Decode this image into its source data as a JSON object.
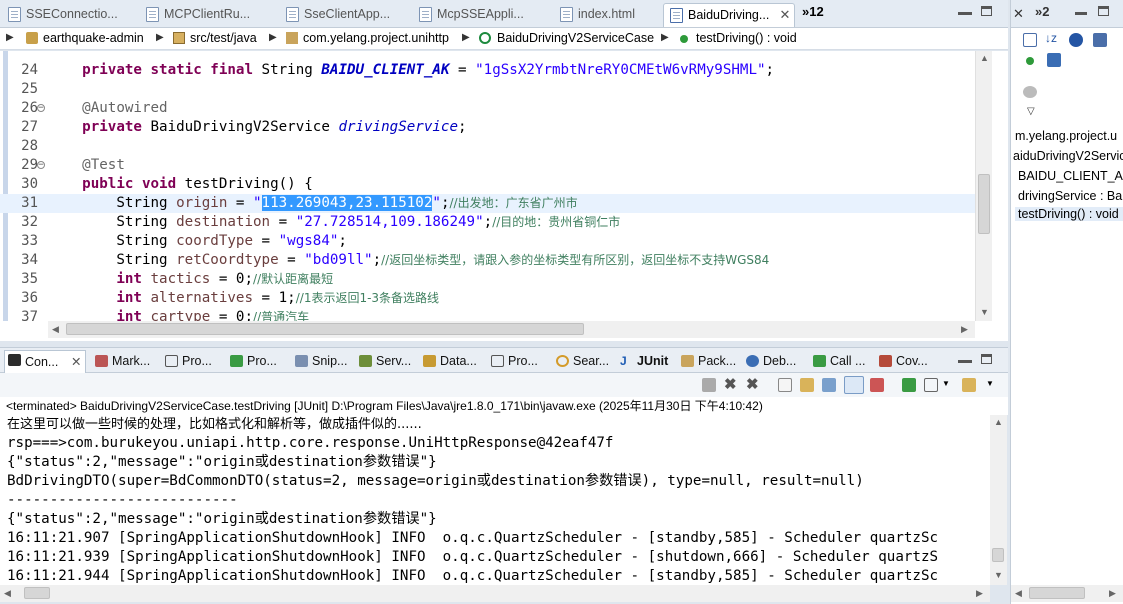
{
  "editor_tabs": [
    {
      "label": "SSEConnectio..."
    },
    {
      "label": "MCPClientRu..."
    },
    {
      "label": "SseClientApp..."
    },
    {
      "label": "McpSSEAppli..."
    },
    {
      "label": "index.html"
    },
    {
      "label": "BaiduDriving..."
    }
  ],
  "editor_overflow": "»12",
  "breadcrumb": {
    "project": "earthquake-admin",
    "folder": "src/test/java",
    "package": "com.yelang.project.unihttp",
    "class": "BaiduDrivingV2ServiceCase",
    "method": "testDriving() : void"
  },
  "code_lines": [
    {
      "n": "24",
      "parts": [
        [
          "    ",
          ""
        ],
        [
          "private static final",
          "kw"
        ],
        [
          " String ",
          ""
        ],
        [
          "BAIDU_CLIENT_AK",
          "fld"
        ],
        [
          " = ",
          ""
        ],
        [
          "\"1gSsX2YrmbtNreRY0CMEtW6vRMy9SHML\"",
          "st"
        ],
        [
          ";",
          ""
        ]
      ]
    },
    {
      "n": "25",
      "parts": []
    },
    {
      "n": "26",
      "parts": [
        [
          "    ",
          ""
        ],
        [
          "@Autowired",
          "an"
        ]
      ]
    },
    {
      "n": "27",
      "parts": [
        [
          "    ",
          ""
        ],
        [
          "private",
          "kw"
        ],
        [
          " BaiduDrivingV2Service ",
          ""
        ],
        [
          "drivingService",
          "fld2"
        ],
        [
          ";",
          ""
        ]
      ]
    },
    {
      "n": "28",
      "parts": []
    },
    {
      "n": "29",
      "parts": [
        [
          "    ",
          ""
        ],
        [
          "@Test",
          "an"
        ]
      ]
    },
    {
      "n": "30",
      "parts": [
        [
          "    ",
          ""
        ],
        [
          "public void",
          "kw"
        ],
        [
          " testDriving() {",
          ""
        ]
      ]
    },
    {
      "n": "31",
      "parts": [
        [
          "        String ",
          ""
        ],
        [
          "origin",
          "vr"
        ],
        [
          " = ",
          ""
        ],
        [
          "\"",
          "st"
        ],
        [
          "113.269043,23.115102",
          "sel"
        ],
        [
          "\"",
          "st"
        ],
        [
          ";",
          ""
        ],
        [
          "//出发地：广东省广州市",
          "cm"
        ]
      ]
    },
    {
      "n": "32",
      "parts": [
        [
          "        String ",
          ""
        ],
        [
          "destination",
          "vr"
        ],
        [
          " = ",
          ""
        ],
        [
          "\"27.728514,109.186249\"",
          "st"
        ],
        [
          ";",
          ""
        ],
        [
          "//目的地：贵州省铜仁市",
          "cm"
        ]
      ]
    },
    {
      "n": "33",
      "parts": [
        [
          "        String ",
          ""
        ],
        [
          "coordType",
          "vr"
        ],
        [
          " = ",
          ""
        ],
        [
          "\"wgs84\"",
          "st"
        ],
        [
          ";",
          ""
        ]
      ]
    },
    {
      "n": "34",
      "parts": [
        [
          "        String ",
          ""
        ],
        [
          "retCoordtype",
          "vr"
        ],
        [
          " = ",
          ""
        ],
        [
          "\"bd09ll\"",
          "st"
        ],
        [
          ";",
          ""
        ],
        [
          "//返回坐标类型，请跟入参的坐标类型有所区别，返回坐标不支持WGS84",
          "cm"
        ]
      ]
    },
    {
      "n": "35",
      "parts": [
        [
          "        ",
          ""
        ],
        [
          "int",
          "kw"
        ],
        [
          " ",
          ""
        ],
        [
          "tactics",
          "vr"
        ],
        [
          " = 0;",
          ""
        ],
        [
          "//默认距离最短",
          "cm"
        ]
      ]
    },
    {
      "n": "36",
      "parts": [
        [
          "        ",
          ""
        ],
        [
          "int",
          "kw"
        ],
        [
          " ",
          ""
        ],
        [
          "alternatives",
          "vr"
        ],
        [
          " = 1;",
          ""
        ],
        [
          "//1表示返回1-3条备选路线",
          "cm"
        ]
      ]
    },
    {
      "n": "37",
      "parts": [
        [
          "        ",
          ""
        ],
        [
          "int",
          "kw"
        ],
        [
          " ",
          ""
        ],
        [
          "cartype",
          "vr"
        ],
        [
          " = 0;",
          ""
        ],
        [
          "//普通汽车",
          "cm"
        ]
      ]
    }
  ],
  "console_tabs": [
    {
      "label": "Con..."
    },
    {
      "label": "Mark..."
    },
    {
      "label": "Pro..."
    },
    {
      "label": "Pro..."
    },
    {
      "label": "Snip..."
    },
    {
      "label": "Serv..."
    },
    {
      "label": "Data..."
    },
    {
      "label": "Pro..."
    },
    {
      "label": "Sear..."
    },
    {
      "label": "JUnit"
    },
    {
      "label": "Pack..."
    },
    {
      "label": "Deb..."
    },
    {
      "label": "Call ..."
    },
    {
      "label": "Cov..."
    }
  ],
  "console_status": "<terminated> BaiduDrivingV2ServiceCase.testDriving [JUnit] D:\\Program Files\\Java\\jre1.8.0_171\\bin\\javaw.exe  (2025年11月30日 下午4:10:42)",
  "console_lines": [
    "在这里可以做一些时候的处理，比如格式化和解析等，做成插件似的......",
    "rsp===>com.burukeyou.uniapi.http.core.response.UniHttpResponse@42eaf47f",
    "{\"status\":2,\"message\":\"origin或destination参数错误\"}",
    "BdDrivingDTO(super=BdCommonDTO(status=2, message=origin或destination参数错误), type=null, result=null)",
    "---------------------------",
    "{\"status\":2,\"message\":\"origin或destination参数错误\"}",
    "16:11:21.907 [SpringApplicationShutdownHook] INFO  o.q.c.QuartzScheduler - [standby,585] - Scheduler quartzSc",
    "16:11:21.939 [SpringApplicationShutdownHook] INFO  o.q.c.QuartzScheduler - [shutdown,666] - Scheduler quartzS",
    "16:11:21.944 [SpringApplicationShutdownHook] INFO  o.q.c.QuartzScheduler - [standby,585] - Scheduler quartzSc"
  ],
  "outline": {
    "overflow": "»2",
    "items": [
      "m.yelang.project.u",
      "aiduDrivingV2Servic",
      "BAIDU_CLIENT_AK",
      "drivingService : Ba",
      "testDriving() : void"
    ]
  },
  "colors": {
    "keyword": "#7f0055",
    "string": "#2a00ff",
    "comment": "#3f7f5f",
    "field": "#0000c0",
    "selection": "#3399ff"
  }
}
